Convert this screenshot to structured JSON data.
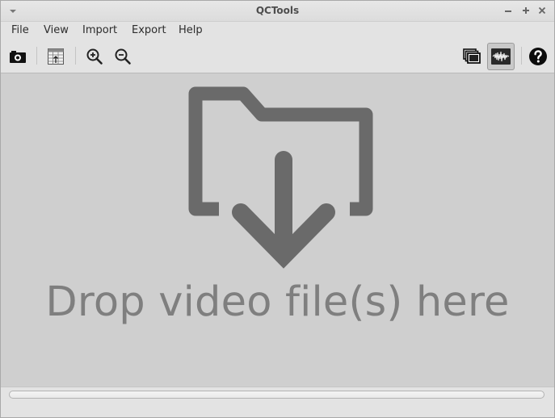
{
  "window": {
    "title": "QCTools"
  },
  "menubar": {
    "items": [
      {
        "label": "File"
      },
      {
        "label": "View"
      },
      {
        "label": "Import"
      },
      {
        "label": "Export"
      },
      {
        "label": "Help"
      }
    ]
  },
  "toolbar": {
    "buttons": [
      {
        "icon": "open-file-icon"
      },
      {
        "icon": "export-table-icon"
      },
      {
        "icon": "zoom-in-icon"
      },
      {
        "icon": "zoom-out-icon"
      },
      {
        "icon": "window-stack-icon"
      },
      {
        "icon": "waveform-icon",
        "active": true
      },
      {
        "icon": "help-icon"
      }
    ]
  },
  "dropzone": {
    "text": "Drop video file(s) here",
    "icon": "folder-download-icon"
  },
  "colors": {
    "background": "#cfcfcf",
    "icon": "#6a6a6a",
    "text": "#7f7f7f"
  }
}
